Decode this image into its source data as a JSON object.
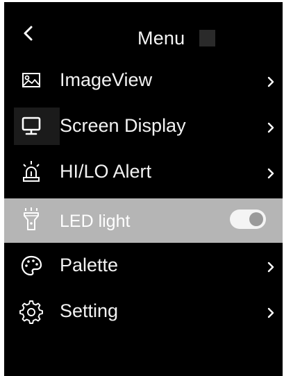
{
  "header": {
    "back_icon": "chevron-left-icon",
    "title": "Menu"
  },
  "menu": {
    "items": [
      {
        "label": "ImageView",
        "icon": "image-icon",
        "control": "chevron-right-icon"
      },
      {
        "label": "Screen Display",
        "icon": "monitor-icon",
        "control": "chevron-right-icon"
      },
      {
        "label": "HI/LO Alert",
        "icon": "alarm-beacon-icon",
        "control": "chevron-right-icon"
      },
      {
        "label": "LED light",
        "icon": "flashlight-icon",
        "control": "toggle",
        "toggle_on": true,
        "selected": true
      },
      {
        "label": "Palette",
        "icon": "palette-icon",
        "control": "chevron-right-icon"
      },
      {
        "label": "Setting",
        "icon": "gear-icon",
        "control": "chevron-right-icon"
      }
    ]
  },
  "colors": {
    "background": "#000000",
    "text": "#ffffff",
    "selected_row": "#b5b5b5",
    "toggle_track": "#f4f4f4",
    "toggle_knob": "#9a9a9a"
  }
}
